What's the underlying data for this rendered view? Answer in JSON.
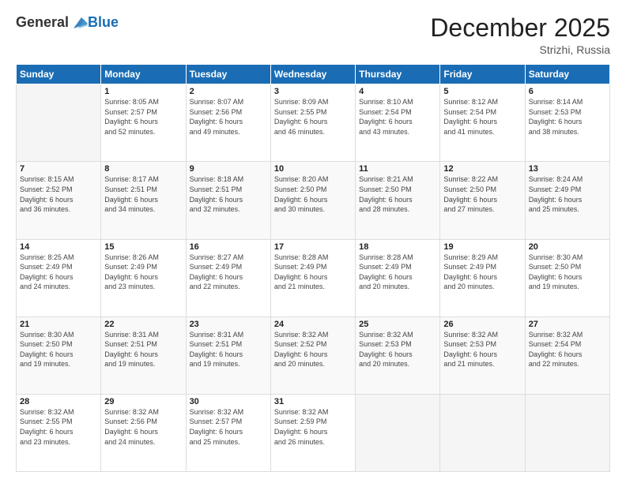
{
  "header": {
    "logo_general": "General",
    "logo_blue": "Blue",
    "month_title": "December 2025",
    "location": "Strizhi, Russia"
  },
  "days_of_week": [
    "Sunday",
    "Monday",
    "Tuesday",
    "Wednesday",
    "Thursday",
    "Friday",
    "Saturday"
  ],
  "weeks": [
    [
      {
        "day": "",
        "info": ""
      },
      {
        "day": "1",
        "info": "Sunrise: 8:05 AM\nSunset: 2:57 PM\nDaylight: 6 hours\nand 52 minutes."
      },
      {
        "day": "2",
        "info": "Sunrise: 8:07 AM\nSunset: 2:56 PM\nDaylight: 6 hours\nand 49 minutes."
      },
      {
        "day": "3",
        "info": "Sunrise: 8:09 AM\nSunset: 2:55 PM\nDaylight: 6 hours\nand 46 minutes."
      },
      {
        "day": "4",
        "info": "Sunrise: 8:10 AM\nSunset: 2:54 PM\nDaylight: 6 hours\nand 43 minutes."
      },
      {
        "day": "5",
        "info": "Sunrise: 8:12 AM\nSunset: 2:54 PM\nDaylight: 6 hours\nand 41 minutes."
      },
      {
        "day": "6",
        "info": "Sunrise: 8:14 AM\nSunset: 2:53 PM\nDaylight: 6 hours\nand 38 minutes."
      }
    ],
    [
      {
        "day": "7",
        "info": "Sunrise: 8:15 AM\nSunset: 2:52 PM\nDaylight: 6 hours\nand 36 minutes."
      },
      {
        "day": "8",
        "info": "Sunrise: 8:17 AM\nSunset: 2:51 PM\nDaylight: 6 hours\nand 34 minutes."
      },
      {
        "day": "9",
        "info": "Sunrise: 8:18 AM\nSunset: 2:51 PM\nDaylight: 6 hours\nand 32 minutes."
      },
      {
        "day": "10",
        "info": "Sunrise: 8:20 AM\nSunset: 2:50 PM\nDaylight: 6 hours\nand 30 minutes."
      },
      {
        "day": "11",
        "info": "Sunrise: 8:21 AM\nSunset: 2:50 PM\nDaylight: 6 hours\nand 28 minutes."
      },
      {
        "day": "12",
        "info": "Sunrise: 8:22 AM\nSunset: 2:50 PM\nDaylight: 6 hours\nand 27 minutes."
      },
      {
        "day": "13",
        "info": "Sunrise: 8:24 AM\nSunset: 2:49 PM\nDaylight: 6 hours\nand 25 minutes."
      }
    ],
    [
      {
        "day": "14",
        "info": "Sunrise: 8:25 AM\nSunset: 2:49 PM\nDaylight: 6 hours\nand 24 minutes."
      },
      {
        "day": "15",
        "info": "Sunrise: 8:26 AM\nSunset: 2:49 PM\nDaylight: 6 hours\nand 23 minutes."
      },
      {
        "day": "16",
        "info": "Sunrise: 8:27 AM\nSunset: 2:49 PM\nDaylight: 6 hours\nand 22 minutes."
      },
      {
        "day": "17",
        "info": "Sunrise: 8:28 AM\nSunset: 2:49 PM\nDaylight: 6 hours\nand 21 minutes."
      },
      {
        "day": "18",
        "info": "Sunrise: 8:28 AM\nSunset: 2:49 PM\nDaylight: 6 hours\nand 20 minutes."
      },
      {
        "day": "19",
        "info": "Sunrise: 8:29 AM\nSunset: 2:49 PM\nDaylight: 6 hours\nand 20 minutes."
      },
      {
        "day": "20",
        "info": "Sunrise: 8:30 AM\nSunset: 2:50 PM\nDaylight: 6 hours\nand 19 minutes."
      }
    ],
    [
      {
        "day": "21",
        "info": "Sunrise: 8:30 AM\nSunset: 2:50 PM\nDaylight: 6 hours\nand 19 minutes."
      },
      {
        "day": "22",
        "info": "Sunrise: 8:31 AM\nSunset: 2:51 PM\nDaylight: 6 hours\nand 19 minutes."
      },
      {
        "day": "23",
        "info": "Sunrise: 8:31 AM\nSunset: 2:51 PM\nDaylight: 6 hours\nand 19 minutes."
      },
      {
        "day": "24",
        "info": "Sunrise: 8:32 AM\nSunset: 2:52 PM\nDaylight: 6 hours\nand 20 minutes."
      },
      {
        "day": "25",
        "info": "Sunrise: 8:32 AM\nSunset: 2:53 PM\nDaylight: 6 hours\nand 20 minutes."
      },
      {
        "day": "26",
        "info": "Sunrise: 8:32 AM\nSunset: 2:53 PM\nDaylight: 6 hours\nand 21 minutes."
      },
      {
        "day": "27",
        "info": "Sunrise: 8:32 AM\nSunset: 2:54 PM\nDaylight: 6 hours\nand 22 minutes."
      }
    ],
    [
      {
        "day": "28",
        "info": "Sunrise: 8:32 AM\nSunset: 2:55 PM\nDaylight: 6 hours\nand 23 minutes."
      },
      {
        "day": "29",
        "info": "Sunrise: 8:32 AM\nSunset: 2:56 PM\nDaylight: 6 hours\nand 24 minutes."
      },
      {
        "day": "30",
        "info": "Sunrise: 8:32 AM\nSunset: 2:57 PM\nDaylight: 6 hours\nand 25 minutes."
      },
      {
        "day": "31",
        "info": "Sunrise: 8:32 AM\nSunset: 2:59 PM\nDaylight: 6 hours\nand 26 minutes."
      },
      {
        "day": "",
        "info": ""
      },
      {
        "day": "",
        "info": ""
      },
      {
        "day": "",
        "info": ""
      }
    ]
  ]
}
